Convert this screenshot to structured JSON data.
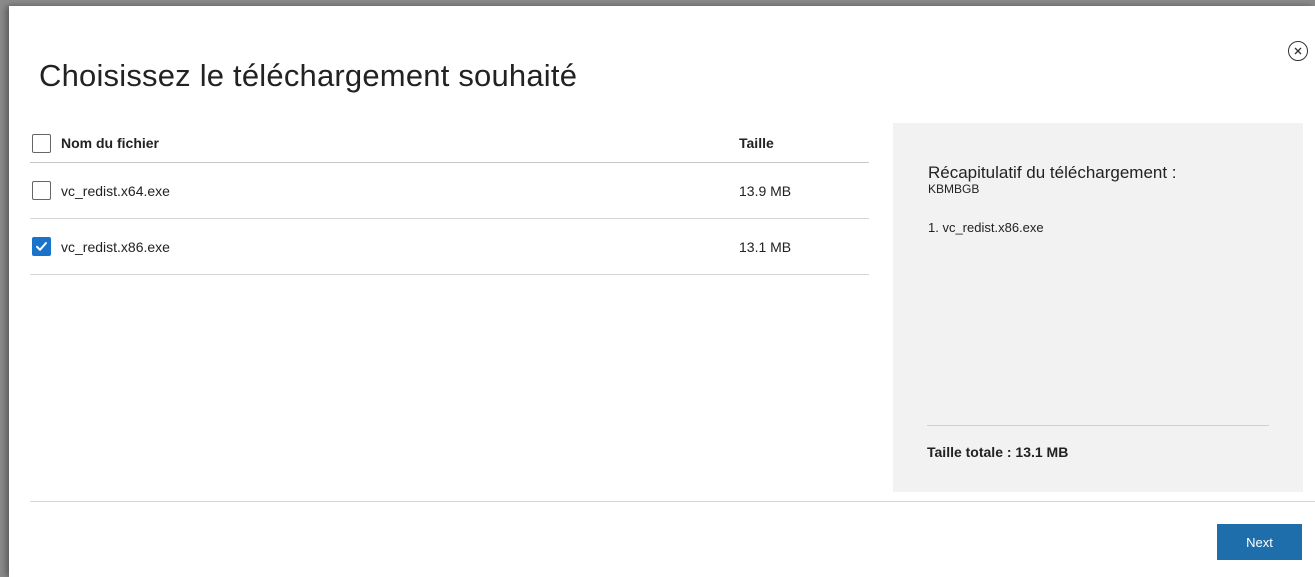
{
  "dialog": {
    "title": "Choisissez le téléchargement souhaité",
    "close_icon": "close-circle-icon"
  },
  "table": {
    "headers": {
      "name": "Nom du fichier",
      "size": "Taille"
    },
    "select_all_checked": false,
    "files": [
      {
        "name": "vc_redist.x64.exe",
        "size": "13.9 MB",
        "checked": false
      },
      {
        "name": "vc_redist.x86.exe",
        "size": "13.1 MB",
        "checked": true
      }
    ]
  },
  "summary": {
    "title": "Récapitulatif du téléchargement :",
    "code": "KBMBGB",
    "items": [
      "1. vc_redist.x86.exe"
    ],
    "total": "Taille totale : 13.1 MB"
  },
  "footer": {
    "next_label": "Next"
  },
  "colors": {
    "accent": "#1a73c8",
    "button": "#1e6eab",
    "panel": "#f2f2f2"
  }
}
